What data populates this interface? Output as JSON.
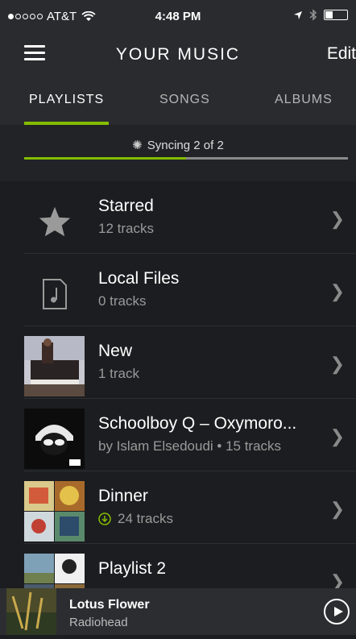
{
  "status_bar": {
    "carrier": "AT&T",
    "time": "4:48 PM"
  },
  "nav": {
    "title": "YOUR MUSIC",
    "edit": "Edit"
  },
  "tabs": [
    {
      "label": "PLAYLISTS",
      "active": true
    },
    {
      "label": "SONGS"
    },
    {
      "label": "ALBUMS"
    }
  ],
  "sync": {
    "text": "Syncing 2 of 2",
    "progress_fraction": 0.5
  },
  "playlists": [
    {
      "title": "Starred",
      "subtitle": "12 tracks",
      "icon": "star-icon"
    },
    {
      "title": "Local Files",
      "subtitle": "0 tracks",
      "icon": "music-file-icon"
    },
    {
      "title": "New",
      "subtitle": "1 track",
      "icon": "album-art"
    },
    {
      "title": "Schoolboy Q – Oxymoro...",
      "subtitle": "by Islam Elsedoudi • 15 tracks",
      "icon": "album-art"
    },
    {
      "title": "Dinner",
      "subtitle": "24 tracks",
      "icon": "album-art",
      "downloaded": true
    },
    {
      "title": "Playlist 2",
      "subtitle": "",
      "icon": "album-art"
    }
  ],
  "now_playing": {
    "track": "Lotus Flower",
    "artist": "Radiohead"
  },
  "colors": {
    "accent": "#84bd00",
    "background": "#1c1d20",
    "bar": "#2a2b2e"
  }
}
